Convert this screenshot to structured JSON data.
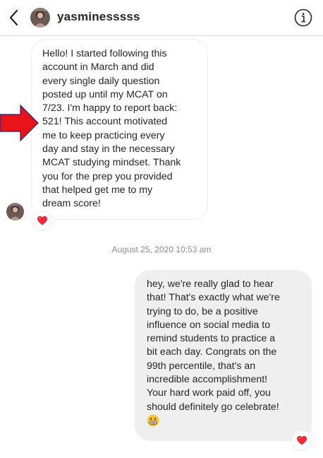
{
  "header": {
    "username": "yasminesssss"
  },
  "messages": {
    "received_text": "Hello! I started following this\naccount in March and did\nevery single daily question\nposted up until my MCAT on\n7/23. I'm happy to report back:\n521! This account motivated\nme to keep practicing every\nday and stay in the necessary\nMCAT studying mindset. Thank\nyou for the prep you provided\nthat helped get me to my\ndream score!",
    "received_reaction": "heart-icon",
    "timestamp": "August 25, 2020 10:53 am",
    "sent_text": "hey, we're really glad to hear\nthat! That's exactly what we're\ntrying to do, be a positive\ninfluence on social media to\nremind students to practice a\nbit each day. Congrats on the\n99th percentile, that's an\nincredible accomplishment!\nYour hard work paid off, you\nshould definitely go celebrate!",
    "sent_emoji": "grimacing-smile-emoji",
    "sent_reaction": "heart-icon"
  },
  "colors": {
    "arrow": "#e8141a",
    "heart": "#ed2b3a",
    "sent_bubble": "#efefef",
    "timestamp": "#8e8e8e"
  }
}
